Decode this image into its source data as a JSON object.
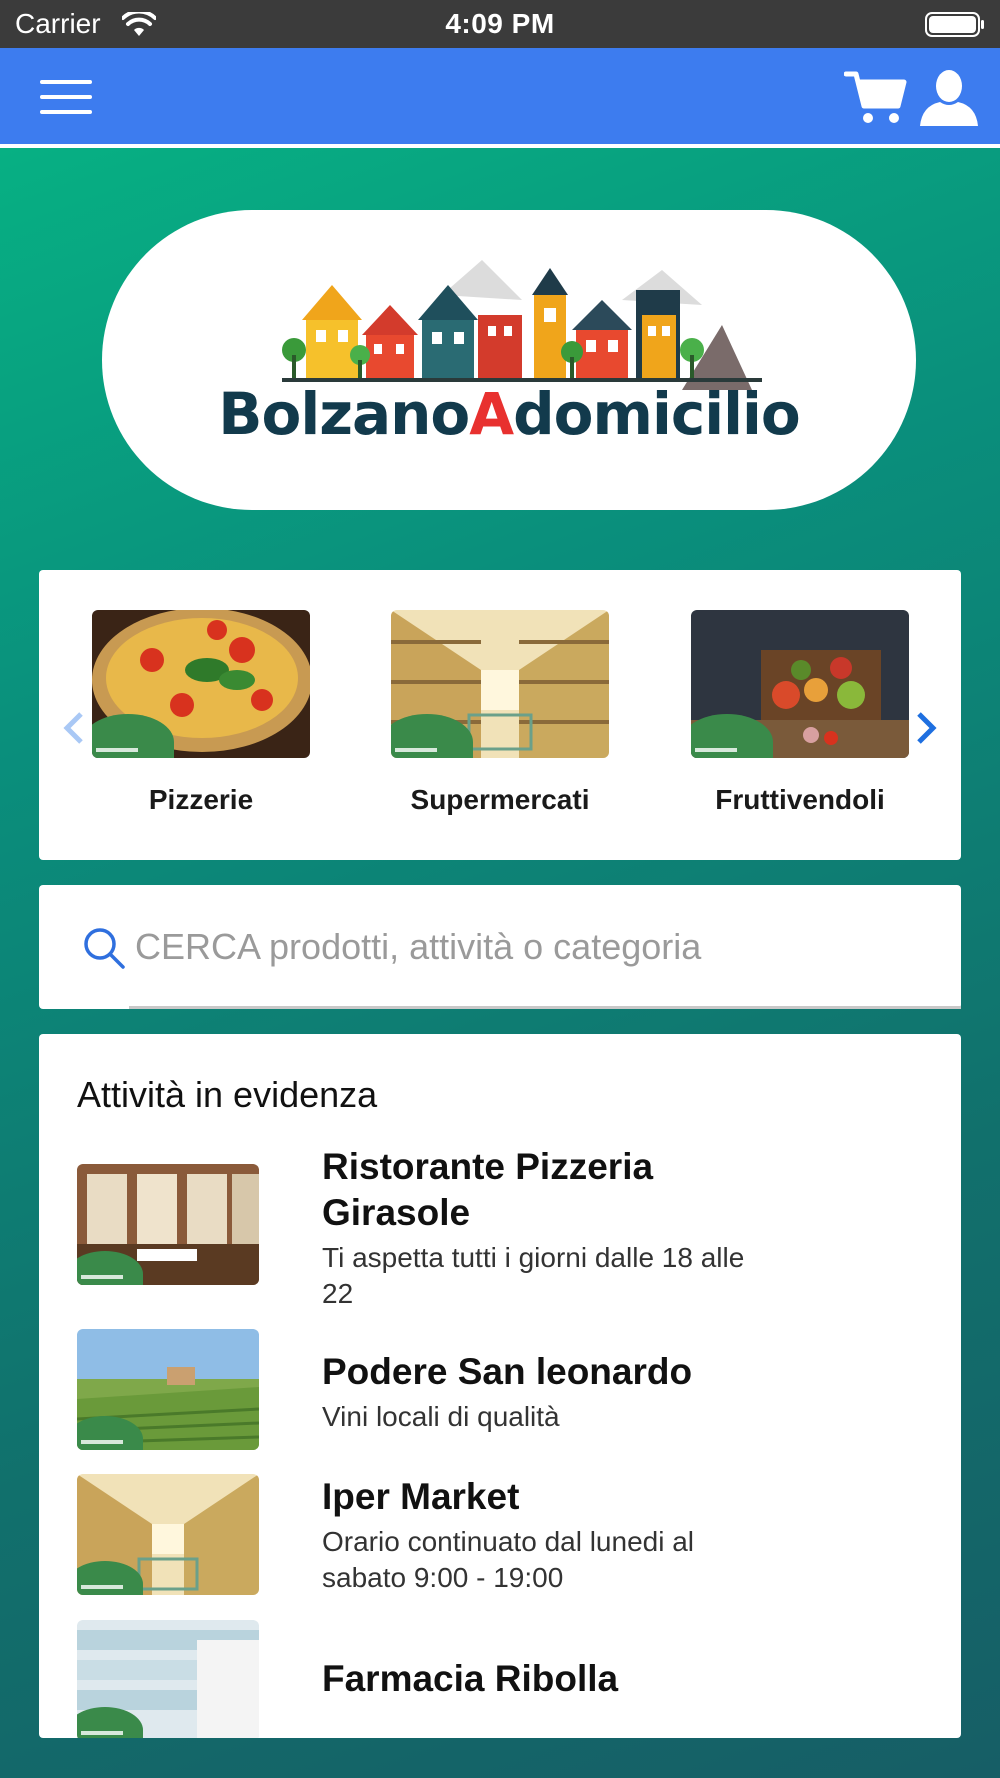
{
  "status_bar": {
    "carrier": "Carrier",
    "time": "4:09 PM"
  },
  "app_bar": {
    "accent_color": "#3d7cef",
    "menu_icon": "hamburger-menu-icon",
    "cart_icon": "shopping-cart-icon",
    "user_icon": "user-profile-icon"
  },
  "logo": {
    "text_part1": "Bolzano",
    "text_accent": "A",
    "text_part2": "domicilio"
  },
  "categories": {
    "items": [
      {
        "label": "Pizzerie",
        "image": "pizza"
      },
      {
        "label": "Supermercati",
        "image": "supermarket-aisle"
      },
      {
        "label": "Fruttivendoli",
        "image": "vegetable-crate"
      }
    ],
    "prev_icon": "chevron-left-icon",
    "next_icon": "chevron-right-icon"
  },
  "search": {
    "placeholder": "CERCA prodotti, attività o categoria",
    "value": ""
  },
  "featured": {
    "title": "Attività in evidenza",
    "items": [
      {
        "name": "Ristorante Pizzeria Girasole",
        "description": "Ti aspetta tutti i giorni dalle 18 alle 22",
        "image": "restaurant-interior"
      },
      {
        "name": "Podere San leonardo",
        "description": "Vini locali di qualità",
        "image": "vineyard-landscape"
      },
      {
        "name": "Iper Market",
        "description": "Orario continuato dal lunedi al sabato 9:00 - 19:00",
        "image": "supermarket-aisle"
      },
      {
        "name": "Farmacia Ribolla",
        "description": "",
        "image": "pharmacy-shelves"
      }
    ]
  }
}
